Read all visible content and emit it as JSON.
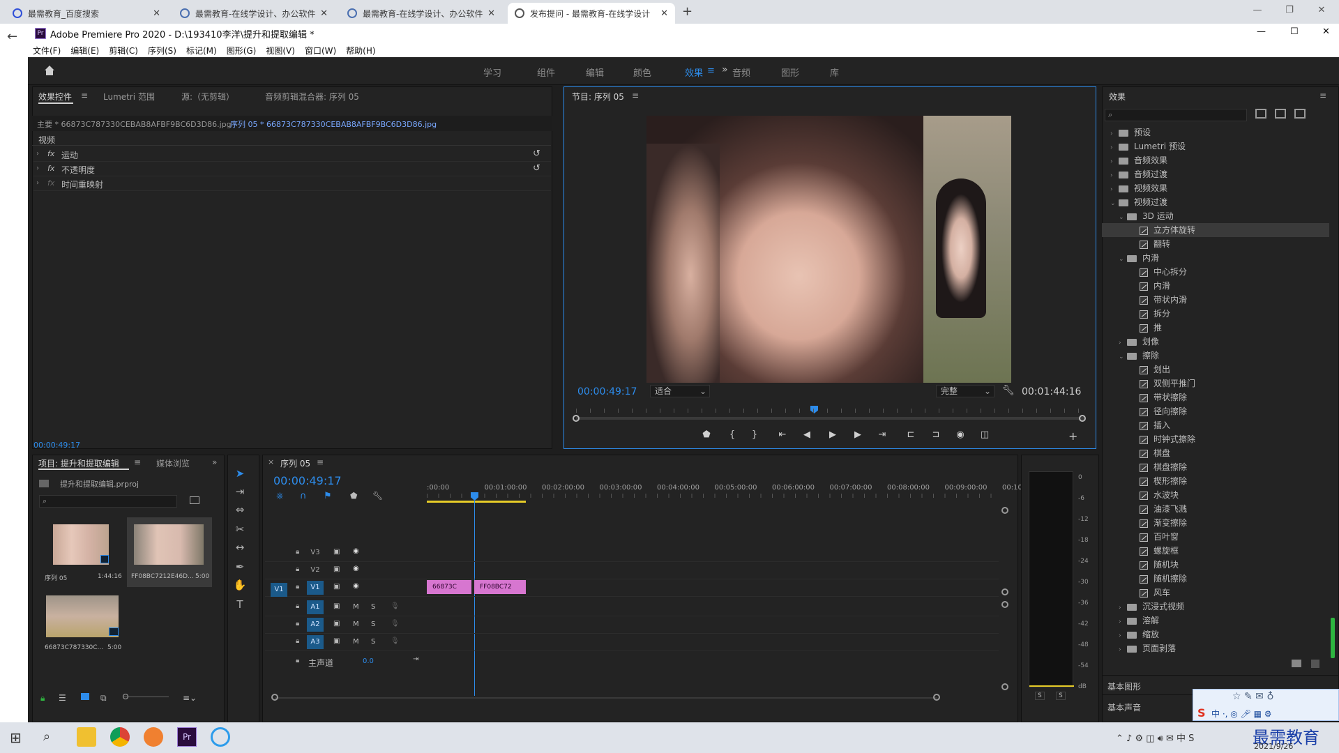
{
  "browser": {
    "tabs": [
      "最需教育_百度搜索",
      "最需教育-在线学设计、办公软件",
      "最需教育-在线学设计、办公软件",
      "发布提问 - 最需教育-在线学设计"
    ],
    "new_tab": "+",
    "back": "←"
  },
  "app": {
    "title": "Adobe Premiere Pro 2020 - D:\\193410李洋\\提升和提取编辑 *",
    "logo": "Pr",
    "menu": [
      "文件(F)",
      "编辑(E)",
      "剪辑(C)",
      "序列(S)",
      "标记(M)",
      "图形(G)",
      "视图(V)",
      "窗口(W)",
      "帮助(H)"
    ],
    "workspaces": [
      "学习",
      "组件",
      "编辑",
      "颜色",
      "效果",
      "音频",
      "图形",
      "库"
    ],
    "active_workspace": "效果",
    "more": "»"
  },
  "effect_controls": {
    "tabs": [
      "效果控件",
      "Lumetri 范围",
      "源:（无剪辑）",
      "音频剪辑混合器: 序列 05"
    ],
    "master": "主要 * 66873C787330CEBAB8AFBF9BC6D3D86.jpg",
    "seq_clip": "序列 05 * 66873C787330CEBAB8AFBF9BC6D3D86.jpg",
    "section": "视频",
    "items": [
      "运动",
      "不透明度",
      "时间重映射"
    ],
    "time": "00:00:49:17"
  },
  "program": {
    "title": "节目: 序列 05",
    "timecode": "00:00:49:17",
    "fit": "适合",
    "quality": "完整",
    "duration": "00:01:44:16"
  },
  "effects": {
    "title": "效果",
    "top": [
      {
        "label": "预设",
        "open": false
      },
      {
        "label": "Lumetri 预设",
        "open": false
      },
      {
        "label": "音频效果",
        "open": false
      },
      {
        "label": "音频过渡",
        "open": false
      },
      {
        "label": "视频效果",
        "open": false
      },
      {
        "label": "视频过渡",
        "open": true
      }
    ],
    "groups": [
      {
        "label": "3D 运动",
        "open": true,
        "items": [
          "立方体旋转",
          "翻转"
        ]
      },
      {
        "label": "内滑",
        "open": true,
        "items": [
          "中心拆分",
          "内滑",
          "带状内滑",
          "拆分",
          "推"
        ]
      },
      {
        "label": "划像",
        "open": false,
        "items": []
      },
      {
        "label": "擦除",
        "open": true,
        "items": [
          "划出",
          "双侧平推门",
          "带状擦除",
          "径向擦除",
          "插入",
          "时钟式擦除",
          "棋盘",
          "棋盘擦除",
          "楔形擦除",
          "水波块",
          "油漆飞溅",
          "渐变擦除",
          "百叶窗",
          "螺旋框",
          "随机块",
          "随机擦除",
          "风车"
        ]
      },
      {
        "label": "沉浸式视频",
        "open": false,
        "items": []
      },
      {
        "label": "溶解",
        "open": false,
        "items": []
      },
      {
        "label": "缩放",
        "open": false,
        "items": []
      },
      {
        "label": "页面剥落",
        "open": false,
        "items": []
      }
    ],
    "selected": "立方体旋转",
    "bottom": [
      "基本图形",
      "基本声音"
    ]
  },
  "project": {
    "tabs": [
      "项目: 提升和提取编辑",
      "媒体浏览"
    ],
    "file": "提升和提取编辑.prproj",
    "items": [
      {
        "name": "序列 05",
        "dur": "1:44:16"
      },
      {
        "name": "FF08BC7212E46D...",
        "dur": "5:00"
      },
      {
        "name": "66873C787330C...",
        "dur": "5:00"
      }
    ]
  },
  "timeline": {
    "tab": "序列 05",
    "time": "00:00:49:17",
    "ruler": [
      ":00:00",
      "00:01:00:00",
      "00:02:00:00",
      "00:03:00:00",
      "00:04:00:00",
      "00:05:00:00",
      "00:06:00:00",
      "00:07:00:00",
      "00:08:00:00",
      "00:09:00:00",
      "00:10"
    ],
    "video_tracks": [
      "V3",
      "V2",
      "V1"
    ],
    "audio_tracks": [
      "A1",
      "A2",
      "A3"
    ],
    "master": "主声道",
    "master_val": "0.0",
    "src": "V1",
    "clips": [
      "66873C",
      "FF08BC72"
    ]
  },
  "meter": {
    "labels": [
      "0",
      "-6",
      "-12",
      "-18",
      "-24",
      "-30",
      "-36",
      "-42",
      "-48",
      "-54",
      "dB"
    ],
    "solo": [
      "S",
      "S"
    ]
  },
  "taskbar": {
    "date": "2021/9/26",
    "brand": "最需教育"
  },
  "colors": {
    "accent": "#2d8ceb",
    "clip": "#d776d0",
    "bg": "#1e1e1e"
  }
}
